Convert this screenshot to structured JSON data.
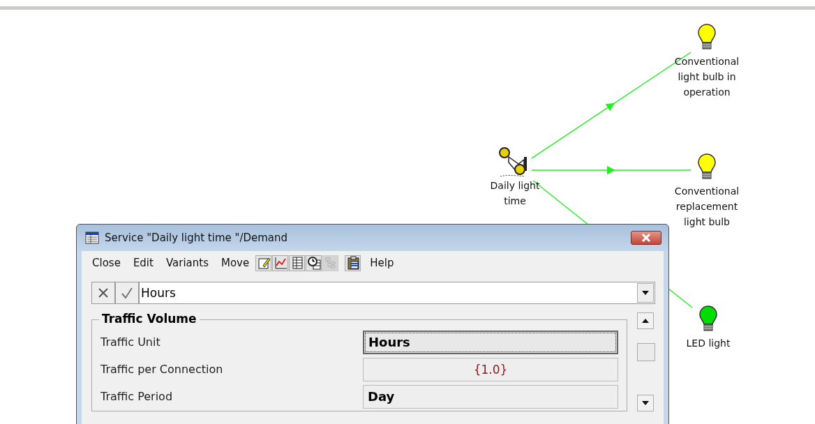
{
  "diagram": {
    "nodes": [
      {
        "kind": "service",
        "label": "Daily light time"
      },
      {
        "kind": "bulb",
        "label": "Conventional light bulb in operation",
        "color": "#ffff00"
      },
      {
        "kind": "bulb",
        "label": "Conventional replacement light bulb",
        "color": "#ffff00"
      },
      {
        "kind": "bulb",
        "label": "LED light",
        "color": "#00dd00"
      }
    ]
  },
  "dialog": {
    "title": "Service \"Daily light time \"/Demand",
    "menu": [
      "Close",
      "Edit",
      "Variants",
      "Move"
    ],
    "toolbar": [
      {
        "kind": "edit",
        "disabled": false
      },
      {
        "kind": "chart",
        "disabled": false
      },
      {
        "kind": "table",
        "disabled": false
      },
      {
        "kind": "clock",
        "disabled": false
      },
      {
        "kind": "tree",
        "disabled": true
      },
      {
        "kind": "clipboard",
        "disabled": false
      }
    ],
    "help": "Help",
    "input": {
      "value": "Hours"
    },
    "group": {
      "title": "Traffic Volume",
      "rows": [
        {
          "label": "Traffic Unit",
          "value": "Hours",
          "kind": "bold",
          "selected": true
        },
        {
          "label": "Traffic per Connection",
          "value": "{1.0}",
          "kind": "formula",
          "selected": false
        },
        {
          "label": "Traffic Period",
          "value": "Day",
          "kind": "bold",
          "selected": false
        }
      ]
    }
  }
}
